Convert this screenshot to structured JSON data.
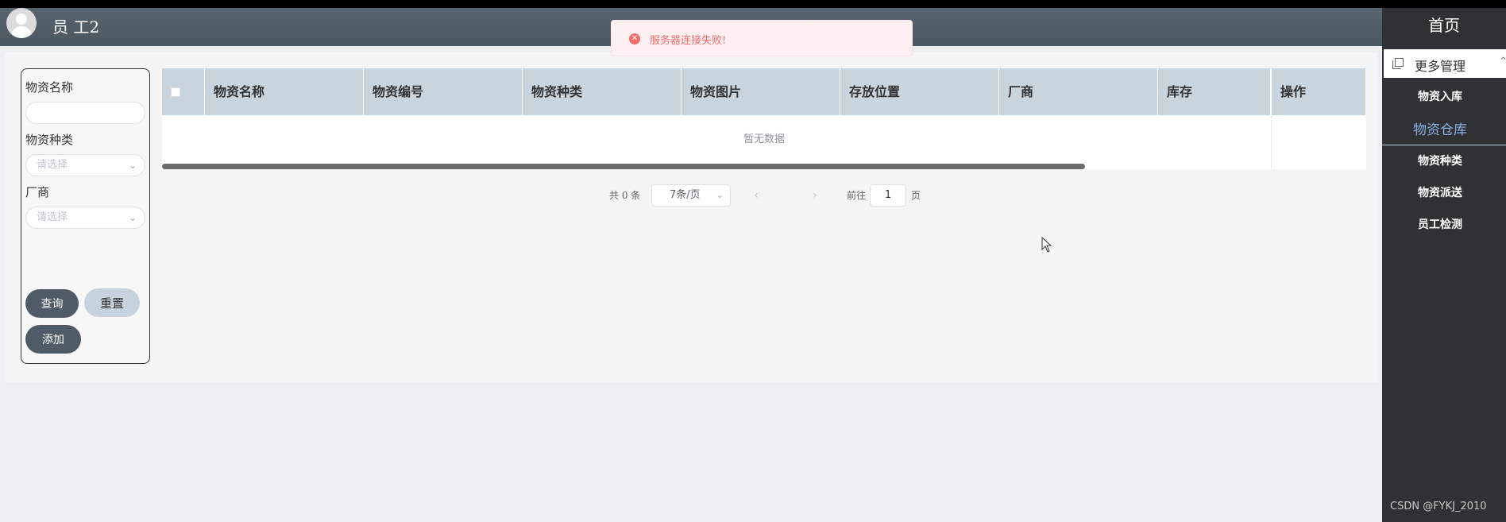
{
  "header": {
    "username": "员 工2"
  },
  "toast": {
    "message": "服务器连接失败!",
    "icon": "error-circle-icon"
  },
  "filter": {
    "name_label": "物资名称",
    "name_value": "",
    "category_label": "物资种类",
    "category_placeholder": "请选择",
    "vendor_label": "厂商",
    "vendor_placeholder": "请选择",
    "query_button": "查询",
    "reset_button": "重置",
    "add_button": "添加"
  },
  "table": {
    "columns": [
      "物资名称",
      "物资编号",
      "物资种类",
      "物资图片",
      "存放位置",
      "厂商",
      "库存",
      "操作"
    ],
    "empty_text": "暂无数据"
  },
  "pagination": {
    "total_text": "共 0 条",
    "page_size": "7条/页",
    "goto_prefix": "前往",
    "goto_value": "1",
    "goto_suffix": "页"
  },
  "sidebar": {
    "home": "首页",
    "more": "更多管理",
    "items": [
      "物资入库",
      "物资仓库",
      "物资种类",
      "物资派送",
      "员工检测"
    ],
    "active_index": 1
  },
  "watermark": "CSDN @FYKJ_2010",
  "colors": {
    "header": "#4f5c67",
    "table_header": "#c8d5df",
    "sidebar": "#303133",
    "error": "#f56c6c",
    "active_menu": "#8ab0e8"
  }
}
